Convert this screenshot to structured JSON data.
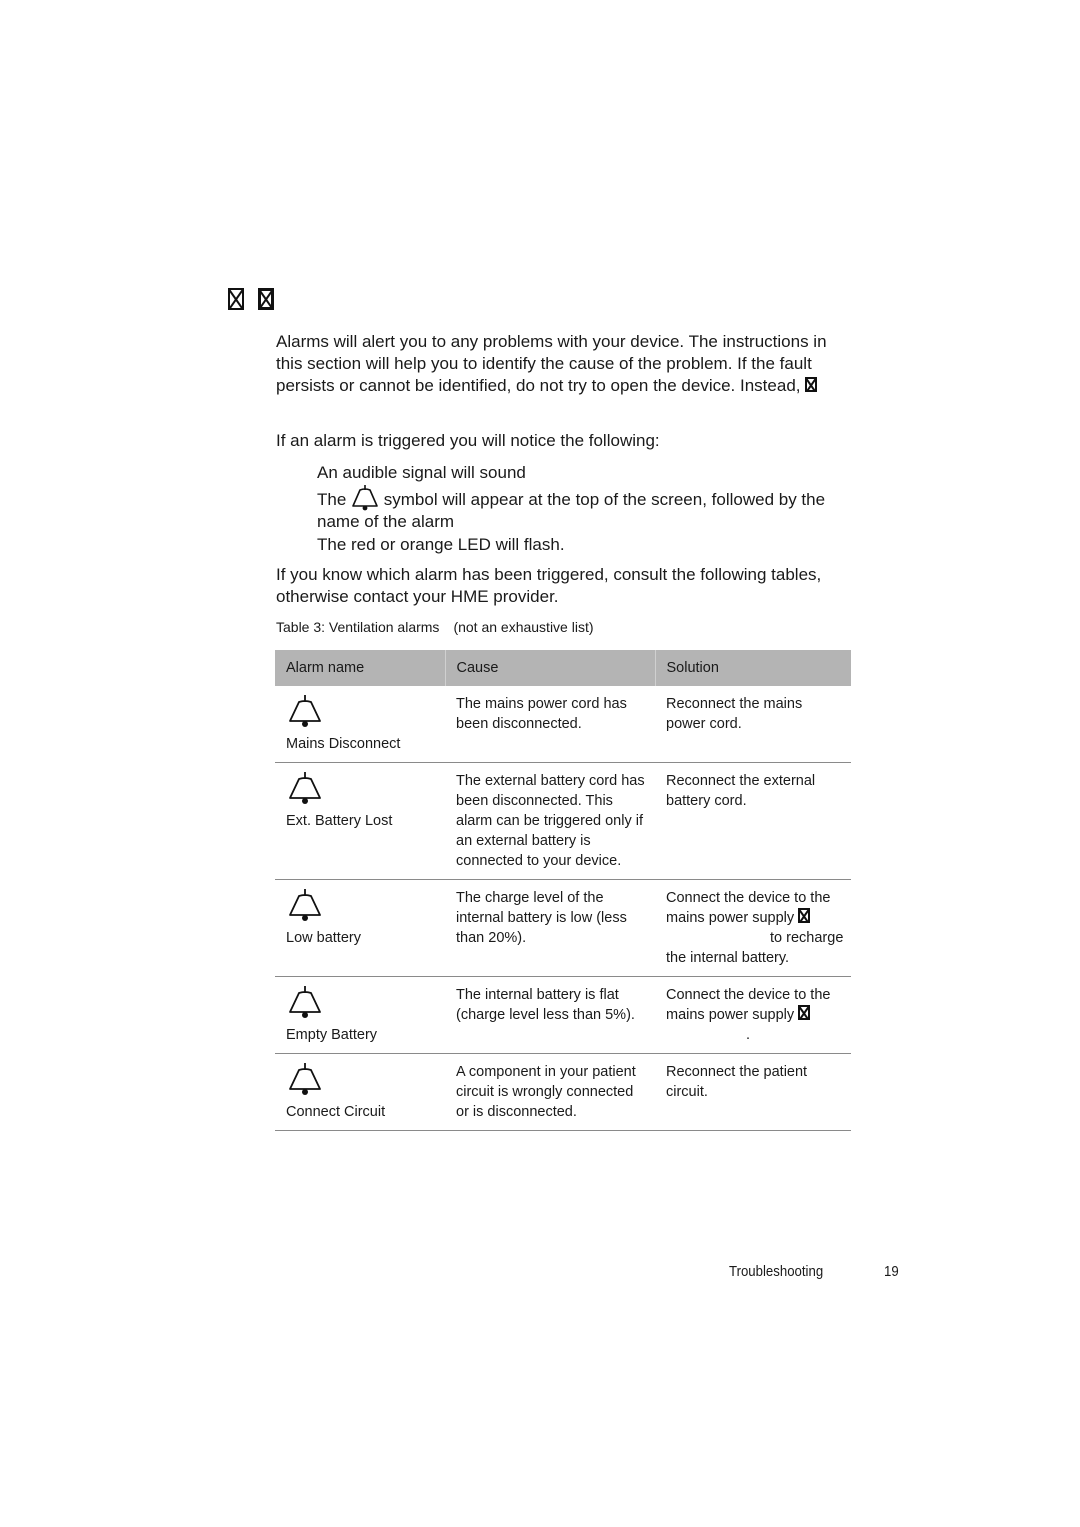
{
  "heading": {
    "glyphs": [
      "missing-glyph",
      "missing-glyph"
    ]
  },
  "intro": {
    "paragraph": "Alarms will alert you to any problems  with your device. The instructions in this section will help  you to identify the cause of the problem. If the fault persists or cannot be identified, do not try to open the device. Instead, ",
    "notice_lead": "If an alarm is triggered you will notice the following:",
    "list": [
      {
        "text": "An audible signal will sound"
      },
      {
        "before_icon": "The ",
        "icon": "alarm-bell-icon",
        "after_icon": " symbol will appear at the top of the screen, followed by the name of the alarm"
      },
      {
        "text": "The red or orange LED will flash."
      }
    ],
    "consult": "If you know which alarm has been triggered, consult the following tables, otherwise contact your HME provider."
  },
  "table": {
    "caption": "Table 3: Ventilation alarms",
    "caption_note": "(not an exhaustive list)",
    "header_color": "#b4b4b4",
    "columns": [
      "Alarm name",
      "Cause",
      "Solution"
    ],
    "rows": [
      {
        "icon": "alarm-bell-icon",
        "name": "Mains Disconnect",
        "cause": "The mains power cord has been disconnected.",
        "solution": "Reconnect the mains power cord."
      },
      {
        "icon": "alarm-bell-icon",
        "name": "Ext. Battery Lost",
        "cause": "The external battery cord has been disconnected. This alarm can be triggered only if an external battery is connected to your device.",
        "solution": "Reconnect the external battery cord."
      },
      {
        "icon": "alarm-bell-icon",
        "name": "Low battery",
        "cause": "The charge level of the internal battery is low (less than 20%).",
        "solution_before": "Connect the device to the mains power supply ",
        "solution_after": " to recharge the internal battery."
      },
      {
        "icon": "alarm-bell-icon",
        "name": "Empty Battery",
        "cause": "The internal battery is flat (charge level less than 5%).",
        "solution_before": "Connect the device to the mains power supply ",
        "solution_after": "."
      },
      {
        "icon": "alarm-bell-icon",
        "name": "Connect Circuit",
        "cause": "A component in your patient circuit is wrongly connected or is disconnected.",
        "solution": "Reconnect the patient circuit."
      }
    ]
  },
  "footer": {
    "section": "Troubleshooting",
    "page": "19"
  }
}
